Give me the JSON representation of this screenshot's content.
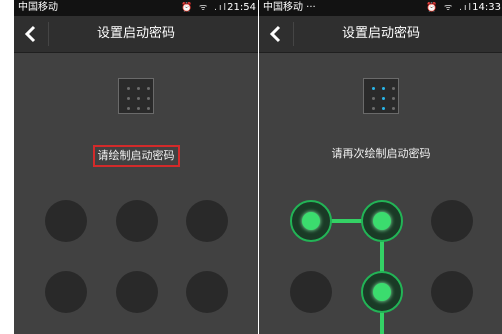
{
  "screens": [
    {
      "status": {
        "carrier": "中国移动",
        "icons": "⏰ ᯤ .ıl",
        "time": "21:54"
      },
      "header": {
        "title": "设置启动密码"
      },
      "prompt": "请绘制启动密码",
      "preview_active": [
        false,
        false,
        false,
        false,
        false,
        false,
        false,
        false,
        false
      ],
      "pattern_active": [
        false,
        false,
        false,
        false,
        false,
        false
      ]
    },
    {
      "status": {
        "carrier": "中国移动 ···",
        "icons": "⏰ ᯤ .ıl",
        "time": "14:33"
      },
      "header": {
        "title": "设置启动密码"
      },
      "prompt": "请再次绘制启动密码",
      "preview_active": [
        true,
        true,
        false,
        false,
        true,
        false,
        false,
        true,
        false
      ],
      "pattern_active": [
        true,
        true,
        false,
        false,
        true,
        false
      ]
    }
  ],
  "colors": {
    "accent_green": "#3bdc6e",
    "highlight_red": "#d32a2a",
    "preview_blue": "#29b6e8"
  }
}
